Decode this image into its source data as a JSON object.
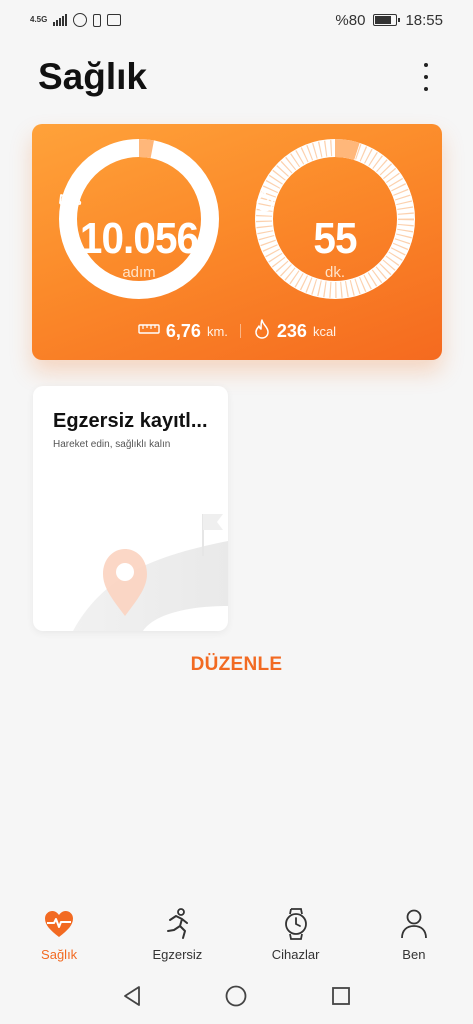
{
  "status_bar": {
    "network": "4.5G",
    "battery_percent": "%80",
    "time": "18:55",
    "icons": [
      "signal-icon",
      "alarm-icon",
      "vibrate-icon",
      "gallery-icon",
      "battery-icon"
    ]
  },
  "header": {
    "title": "Sağlık",
    "menu_icon": "more-vertical-icon"
  },
  "summary": {
    "steps_value": "10.056",
    "steps_unit": "adım",
    "steps_icon": "shoe-icon",
    "steps_progress": 0.03,
    "minutes_value": "55",
    "minutes_unit": "dk.",
    "minutes_icon": "stopwatch-icon",
    "minutes_progress": 0.05,
    "distance_value": "6,76",
    "distance_unit": "km.",
    "distance_icon": "ruler-icon",
    "calories_value": "236",
    "calories_unit": "kcal",
    "calories_icon": "flame-icon"
  },
  "exercise_card": {
    "title": "Egzersiz kayıtl...",
    "subtitle": "Hareket edin, sağlıklı kalın",
    "illustration": "location-pin-icon"
  },
  "edit_button": "DÜZENLE",
  "tabs": [
    {
      "label": "Sağlık",
      "icon": "heart-pulse-icon",
      "active": true
    },
    {
      "label": "Egzersiz",
      "icon": "running-icon",
      "active": false
    },
    {
      "label": "Cihazlar",
      "icon": "watch-icon",
      "active": false
    },
    {
      "label": "Ben",
      "icon": "person-icon",
      "active": false
    }
  ],
  "system_nav": [
    "back-icon",
    "home-icon",
    "recents-icon"
  ],
  "colors": {
    "accent": "#f26a22",
    "card_gradient_start": "#ffa23a",
    "card_gradient_end": "#f56a1f",
    "background": "#f6f6f6"
  }
}
